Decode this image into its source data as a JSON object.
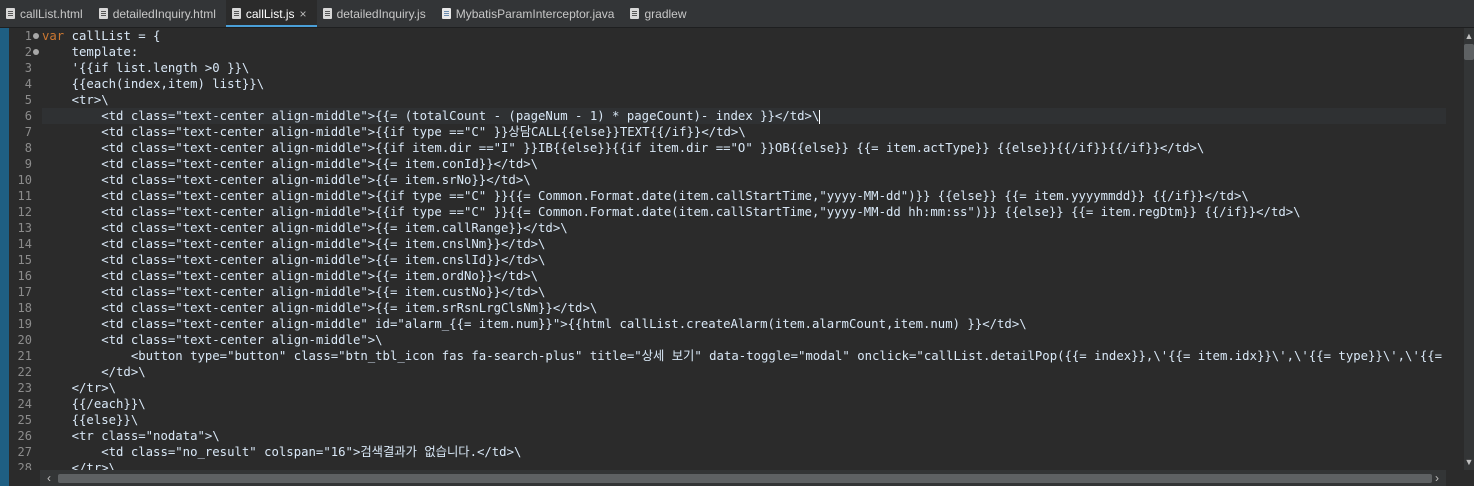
{
  "tabs": [
    {
      "label": "callList.html",
      "icon": "html-file-icon",
      "active": false
    },
    {
      "label": "detailedInquiry.html",
      "icon": "html-file-icon",
      "active": false
    },
    {
      "label": "callList.js",
      "icon": "js-file-icon",
      "active": true,
      "close": "×"
    },
    {
      "label": "detailedInquiry.js",
      "icon": "js-file-icon",
      "active": false
    },
    {
      "label": "MybatisParamInterceptor.java",
      "icon": "java-file-icon",
      "active": false
    },
    {
      "label": "gradlew",
      "icon": "file-icon",
      "active": false
    }
  ],
  "editor": {
    "current_line": 6,
    "lines": [
      {
        "n": "1",
        "text": "var callList = {",
        "fold": true
      },
      {
        "n": "2",
        "text": "    template:",
        "fold": true
      },
      {
        "n": "3",
        "text": "    '{{if list.length >0 }}\\"
      },
      {
        "n": "4",
        "text": "    {{each(index,item) list}}\\"
      },
      {
        "n": "5",
        "text": "    <tr>\\"
      },
      {
        "n": "6",
        "text": "        <td class=\"text-center align-middle\">{{= (totalCount - (pageNum - 1) * pageCount)- index }}</td>\\"
      },
      {
        "n": "7",
        "text": "        <td class=\"text-center align-middle\">{{if type ==\"C\" }}상담CALL{{else}}TEXT{{/if}}</td>\\"
      },
      {
        "n": "8",
        "text": "        <td class=\"text-center align-middle\">{{if item.dir ==\"I\" }}IB{{else}}{{if item.dir ==\"O\" }}OB{{else}} {{= item.actType}} {{else}}{{/if}}{{/if}}</td>\\"
      },
      {
        "n": "9",
        "text": "        <td class=\"text-center align-middle\">{{= item.conId}}</td>\\"
      },
      {
        "n": "10",
        "text": "        <td class=\"text-center align-middle\">{{= item.srNo}}</td>\\"
      },
      {
        "n": "11",
        "text": "        <td class=\"text-center align-middle\">{{if type ==\"C\" }}{{= Common.Format.date(item.callStartTime,\"yyyy-MM-dd\")}} {{else}} {{= item.yyyymmdd}} {{/if}}</td>\\"
      },
      {
        "n": "12",
        "text": "        <td class=\"text-center align-middle\">{{if type ==\"C\" }}{{= Common.Format.date(item.callStartTime,\"yyyy-MM-dd hh:mm:ss\")}} {{else}} {{= item.regDtm}} {{/if}}</td>\\"
      },
      {
        "n": "13",
        "text": "        <td class=\"text-center align-middle\">{{= item.callRange}}</td>\\"
      },
      {
        "n": "14",
        "text": "        <td class=\"text-center align-middle\">{{= item.cnslNm}}</td>\\"
      },
      {
        "n": "15",
        "text": "        <td class=\"text-center align-middle\">{{= item.cnslId}}</td>\\"
      },
      {
        "n": "16",
        "text": "        <td class=\"text-center align-middle\">{{= item.ordNo}}</td>\\"
      },
      {
        "n": "17",
        "text": "        <td class=\"text-center align-middle\">{{= item.custNo}}</td>\\"
      },
      {
        "n": "18",
        "text": "        <td class=\"text-center align-middle\">{{= item.srRsnLrgClsNm}}</td>\\"
      },
      {
        "n": "19",
        "text": "        <td class=\"text-center align-middle\" id=\"alarm_{{= item.num}}\">{{html callList.createAlarm(item.alarmCount,item.num) }}</td>\\"
      },
      {
        "n": "20",
        "text": "        <td class=\"text-center align-middle\">\\"
      },
      {
        "n": "21",
        "text": "            <button type=\"button\" class=\"btn_tbl_icon fas fa-search-plus\" title=\"상세 보기\" data-toggle=\"modal\" onclick=\"callList.detailPop({{= index}},\\'{{= item.idx}}\\',\\'{{= type}}\\',\\'{{= item.p"
      },
      {
        "n": "22",
        "text": "        </td>\\"
      },
      {
        "n": "23",
        "text": "    </tr>\\"
      },
      {
        "n": "24",
        "text": "    {{/each}}\\"
      },
      {
        "n": "25",
        "text": "    {{else}}\\"
      },
      {
        "n": "26",
        "text": "    <tr class=\"nodata\">\\"
      },
      {
        "n": "27",
        "text": "        <td class=\"no_result\" colspan=\"16\">검색결과가 없습니다.</td>\\"
      },
      {
        "n": "28",
        "text": "    </tr>\\"
      }
    ]
  },
  "scrollbars": {
    "up_arrow": "▲",
    "down_arrow": "▼",
    "left_arrow": "‹",
    "right_arrow": "›"
  },
  "colors": {
    "background": "#2b2b2b",
    "tab_bar": "#333537",
    "active_tab_accent": "#4a9fd8",
    "keyword": "#cc7832",
    "code_text": "#d9e8f7",
    "line_number": "#8c8c8c",
    "change_bar": "#1f5f83"
  }
}
